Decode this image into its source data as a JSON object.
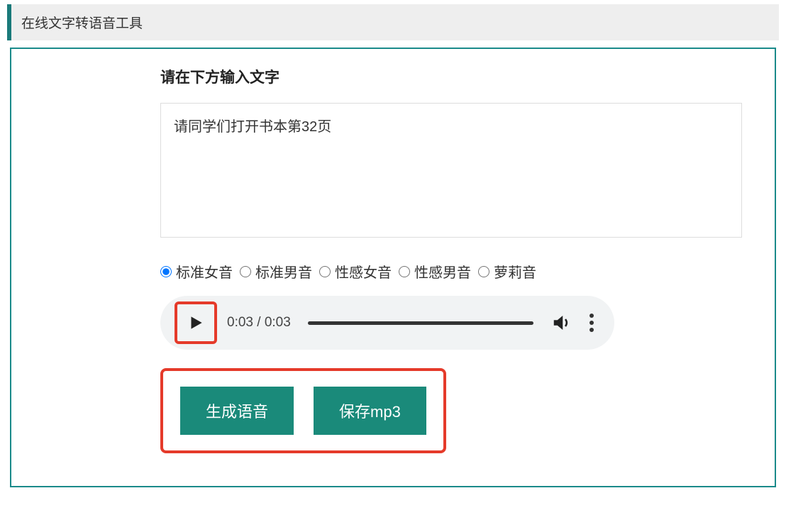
{
  "header": {
    "title": "在线文字转语音工具"
  },
  "main": {
    "input_label": "请在下方输入文字",
    "input_value": "请同学们打开书本第32页",
    "voice_options": [
      {
        "label": "标准女音",
        "selected": true
      },
      {
        "label": "标准男音",
        "selected": false
      },
      {
        "label": "性感女音",
        "selected": false
      },
      {
        "label": "性感男音",
        "selected": false
      },
      {
        "label": "萝莉音",
        "selected": false
      }
    ],
    "audio": {
      "current_time": "0:03",
      "duration": "0:03",
      "time_display": "0:03 / 0:03"
    },
    "buttons": {
      "generate": "生成语音",
      "save": "保存mp3"
    }
  }
}
